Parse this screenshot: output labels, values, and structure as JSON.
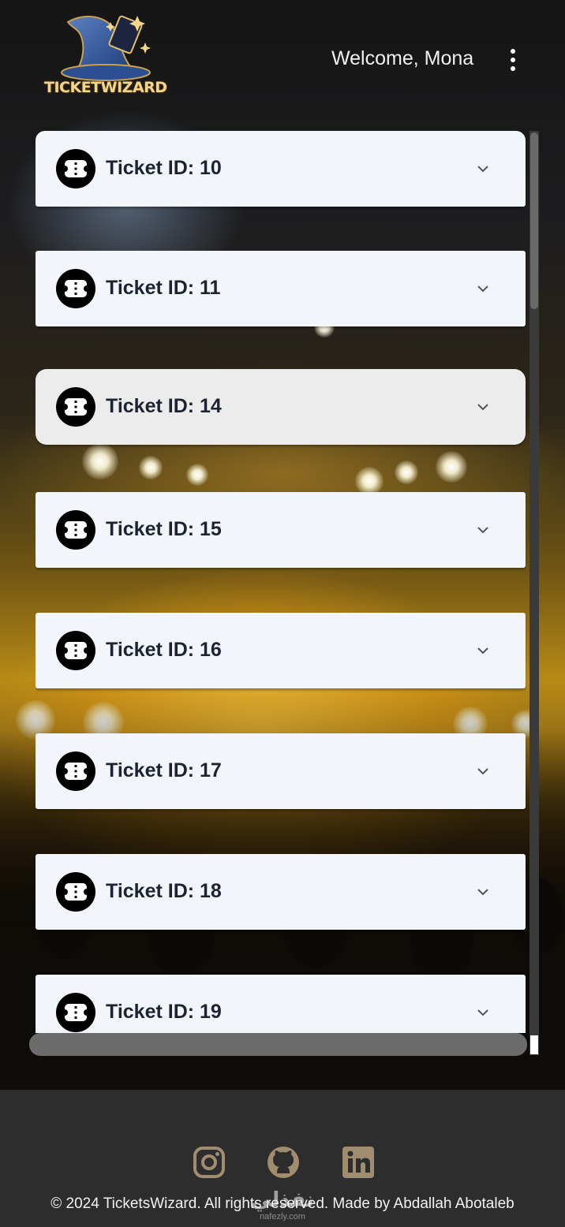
{
  "header": {
    "logo_text": "TICKETWIZARD",
    "welcome": "Welcome, Mona",
    "menu_icon": "more-vertical-icon"
  },
  "tickets": [
    {
      "label": "Ticket ID: 10",
      "icon": "ticket-icon",
      "state": "default"
    },
    {
      "label": "Ticket ID: 11",
      "icon": "ticket-icon",
      "state": "default"
    },
    {
      "label": "Ticket ID: 14",
      "icon": "ticket-icon",
      "state": "hover"
    },
    {
      "label": "Ticket ID: 15",
      "icon": "ticket-icon",
      "state": "default"
    },
    {
      "label": "Ticket ID: 16",
      "icon": "ticket-icon",
      "state": "default"
    },
    {
      "label": "Ticket ID: 17",
      "icon": "ticket-icon",
      "state": "default"
    },
    {
      "label": "Ticket ID: 18",
      "icon": "ticket-icon",
      "state": "default"
    },
    {
      "label": "Ticket ID: 19",
      "icon": "ticket-icon",
      "state": "default"
    }
  ],
  "footer": {
    "social": [
      "instagram-icon",
      "github-icon",
      "linkedin-icon"
    ],
    "copyright": "© 2024 TicketsWizard. All rights reserved. Made by Abdallah Abotaleb",
    "watermark_arabic": "نفذلي",
    "watermark_latin": "nafezly.com"
  },
  "colors": {
    "card_background": "#f2f5fa",
    "card_hover": "#ececec",
    "ticket_text": "#1e2332",
    "footer_background": "#2d2d2d",
    "social_icon": "#a08c6e",
    "logo_gold": "#f1d58d"
  }
}
